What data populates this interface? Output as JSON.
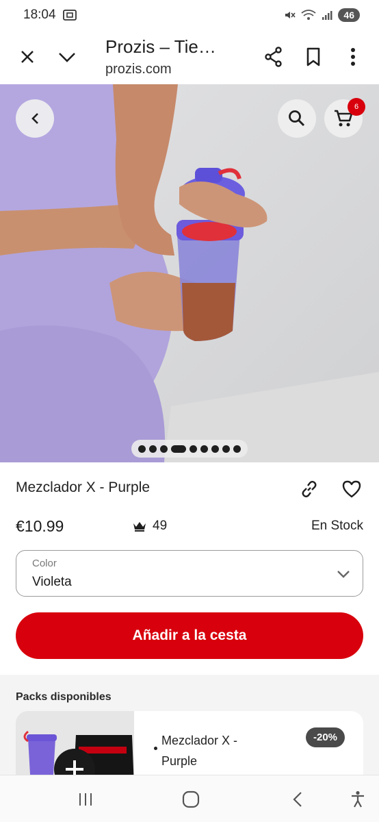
{
  "status_bar": {
    "time": "18:04",
    "battery": "46",
    "icons": [
      "screen-cast-icon",
      "mute-icon",
      "wifi-icon",
      "signal-icon"
    ]
  },
  "browser": {
    "title": "Prozis – Tie…",
    "url": "prozis.com",
    "icons": [
      "close-icon",
      "chevron-down-icon",
      "share-icon",
      "bookmark-icon",
      "more-vert-icon"
    ]
  },
  "hero": {
    "cart_count": "6",
    "carousel": {
      "total": 9,
      "active_index": 3
    },
    "icons": [
      "back-icon",
      "search-icon",
      "cart-icon"
    ]
  },
  "product": {
    "title": "Mezclador X - Purple",
    "price": "€10.99",
    "points": "49",
    "stock": "En Stock"
  },
  "color_select": {
    "label": "Color",
    "value": "Violeta"
  },
  "add_button": "Añadir a la cesta",
  "packs": {
    "title": "Packs disponibles",
    "items": [
      {
        "name": "Mezclador X - Purple",
        "discount": "-20%"
      }
    ]
  },
  "colors": {
    "accent": "#d8000c",
    "discount_badge": "#4a4a4a",
    "shirt": "#b4a7e0"
  }
}
